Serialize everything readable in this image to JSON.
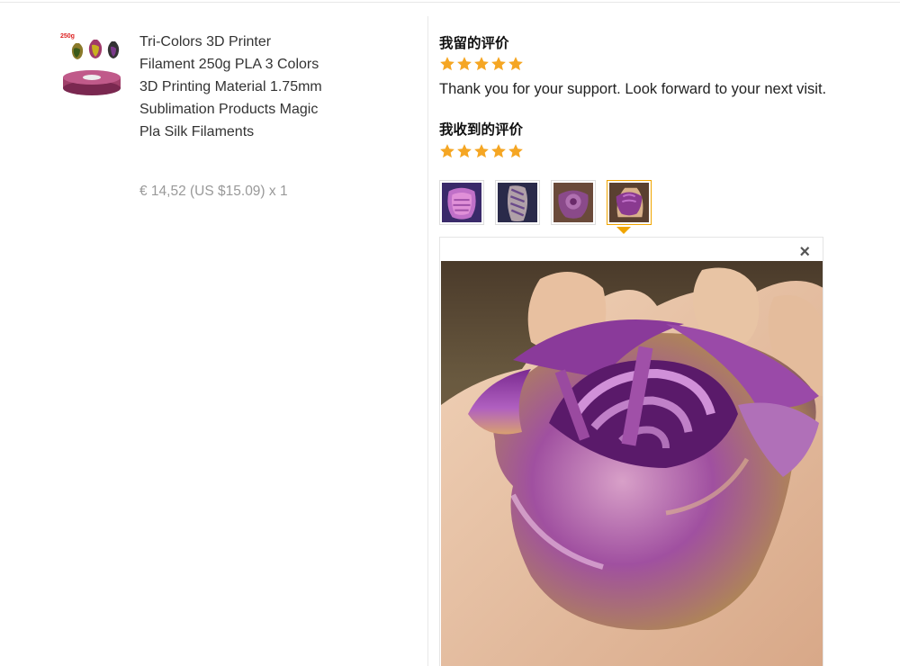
{
  "product": {
    "title": "Tri-Colors 3D Printer Filament 250g PLA 3 Colors 3D Printing Material 1.75mm Sublimation Products Magic Pla Silk Filaments",
    "price": "€ 14,52 (US $15.09) x 1",
    "thumb_badge": "250g"
  },
  "my_review": {
    "heading": "我留的评价",
    "rating": 5,
    "text": "Thank you for your support. Look forward to your next visit."
  },
  "received_review": {
    "heading": "我收到的评价",
    "rating": 5,
    "photos": [
      "photo-1",
      "photo-2",
      "photo-3",
      "photo-4"
    ],
    "selected_photo": 4,
    "close_label": "×"
  },
  "colors": {
    "star": "#f5a623",
    "accent_border": "#f0a500",
    "divider": "#e8e8e8"
  }
}
